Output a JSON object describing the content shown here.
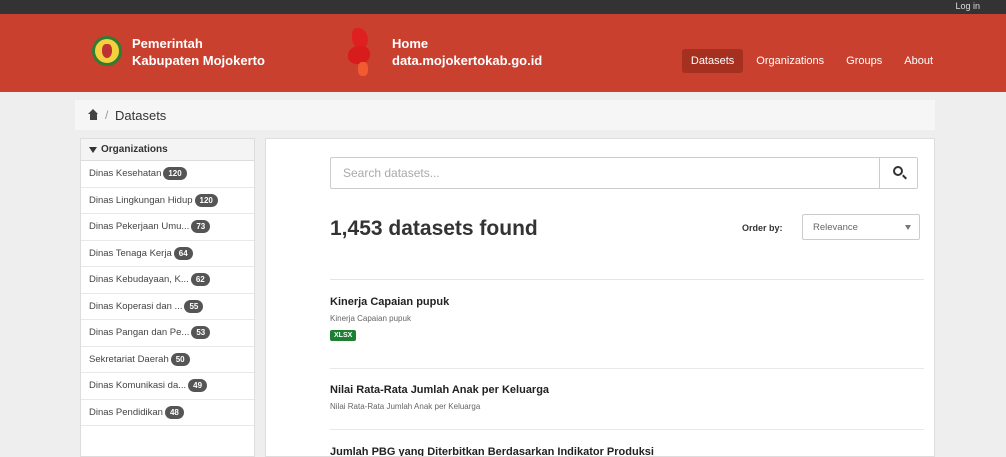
{
  "topbar": {
    "login_label": "Log in"
  },
  "header": {
    "site_left_line1": "Pemerintah",
    "site_left_line2": "Kabupaten Mojokerto",
    "site_right_line1": "Home",
    "site_right_line2": "data.mojokertokab.go.id",
    "nav": [
      {
        "label": "Datasets",
        "active": true
      },
      {
        "label": "Organizations",
        "active": false
      },
      {
        "label": "Groups",
        "active": false
      },
      {
        "label": "About",
        "active": false
      }
    ]
  },
  "breadcrumb": {
    "separator": "/",
    "current": "Datasets"
  },
  "sidebar": {
    "heading": "Organizations",
    "items": [
      {
        "label": "Dinas Kesehatan",
        "count": "120"
      },
      {
        "label": "Dinas Lingkungan Hidup",
        "count": "120"
      },
      {
        "label": "Dinas Pekerjaan Umu...",
        "count": "73"
      },
      {
        "label": "Dinas Tenaga Kerja",
        "count": "64"
      },
      {
        "label": "Dinas Kebudayaan, K...",
        "count": "62"
      },
      {
        "label": "Dinas Koperasi dan ...",
        "count": "55"
      },
      {
        "label": "Dinas Pangan dan Pe...",
        "count": "53"
      },
      {
        "label": "Sekretariat Daerah",
        "count": "50"
      },
      {
        "label": "Dinas Komunikasi da...",
        "count": "49"
      },
      {
        "label": "Dinas Pendidikan",
        "count": "48"
      }
    ]
  },
  "search": {
    "placeholder": "Search datasets..."
  },
  "results": {
    "count_text": "1,453 datasets found",
    "order_label": "Order by:",
    "order_value": "Relevance"
  },
  "datasets": [
    {
      "title": "Kinerja Capaian pupuk",
      "notes": "Kinerja Capaian pupuk",
      "format": "XLSX"
    },
    {
      "title": "Nilai Rata-Rata Jumlah Anak per Keluarga",
      "notes": "Nilai Rata-Rata Jumlah Anak per Keluarga",
      "format": ""
    },
    {
      "title": "Jumlah PBG yang Diterbitkan Berdasarkan Indikator Produksi",
      "notes": "",
      "format": ""
    }
  ],
  "colors": {
    "header": "#c9402f",
    "active_nav": "#a5301f",
    "badge_green": "#1e7e34"
  }
}
